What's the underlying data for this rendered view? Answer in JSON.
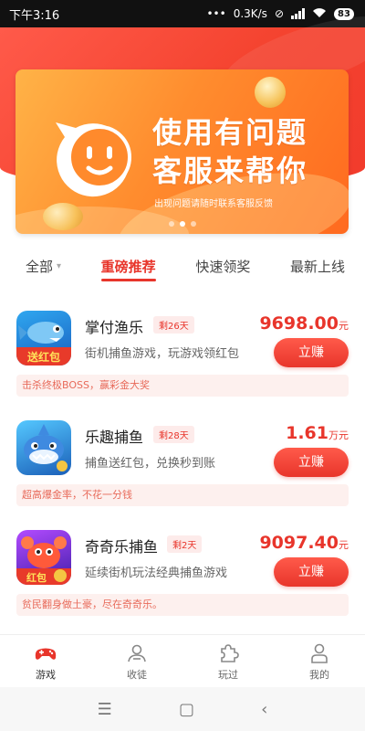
{
  "status_bar": {
    "time": "下午3:16",
    "dots": "•••",
    "net_speed": "0.3K/s",
    "battery": "83"
  },
  "banner": {
    "headline_line1": "使用有问题",
    "headline_line2": "客服来帮你",
    "subtext": "出现问题请随时联系客服反馈",
    "page_count": 3,
    "active_page": 2
  },
  "tabs": [
    {
      "label": "全部",
      "has_dropdown": true
    },
    {
      "label": "重磅推荐",
      "active": true
    },
    {
      "label": "快速领奖"
    },
    {
      "label": "最新上线"
    }
  ],
  "games": [
    {
      "name": "掌付渔乐",
      "remaining": "剩26天",
      "description": "街机捕鱼游戏，玩游戏领红包",
      "price": "9698.00",
      "unit": "元",
      "button": "立赚",
      "tip": "击杀终极BOSS，赢彩金大奖",
      "icon_label": "送红包",
      "icon": "fish-game-icon-blue"
    },
    {
      "name": "乐趣捕鱼",
      "remaining": "剩28天",
      "description": "捕鱼送红包，兑换秒到账",
      "price": "1.61",
      "unit": "万元",
      "button": "立赚",
      "tip": "超高爆金率，不花一分钱",
      "icon_label": "",
      "icon": "shark-game-icon"
    },
    {
      "name": "奇奇乐捕鱼",
      "remaining": "剩2天",
      "description": "延续街机玩法经典捕鱼游戏",
      "price": "9097.40",
      "unit": "元",
      "button": "立赚",
      "tip": "贫民翻身做土豪，尽在奇奇乐。",
      "icon_label": "红包",
      "icon": "crab-game-icon"
    }
  ],
  "bottom_nav": [
    {
      "label": "游戏",
      "icon": "gamepad-icon",
      "active": true
    },
    {
      "label": "收徒",
      "icon": "users-icon"
    },
    {
      "label": "玩过",
      "icon": "puzzle-icon"
    },
    {
      "label": "我的",
      "icon": "person-icon"
    }
  ],
  "colors": {
    "accent": "#e8352b",
    "header": "#f4432f",
    "banner": "#ff8c2e"
  }
}
